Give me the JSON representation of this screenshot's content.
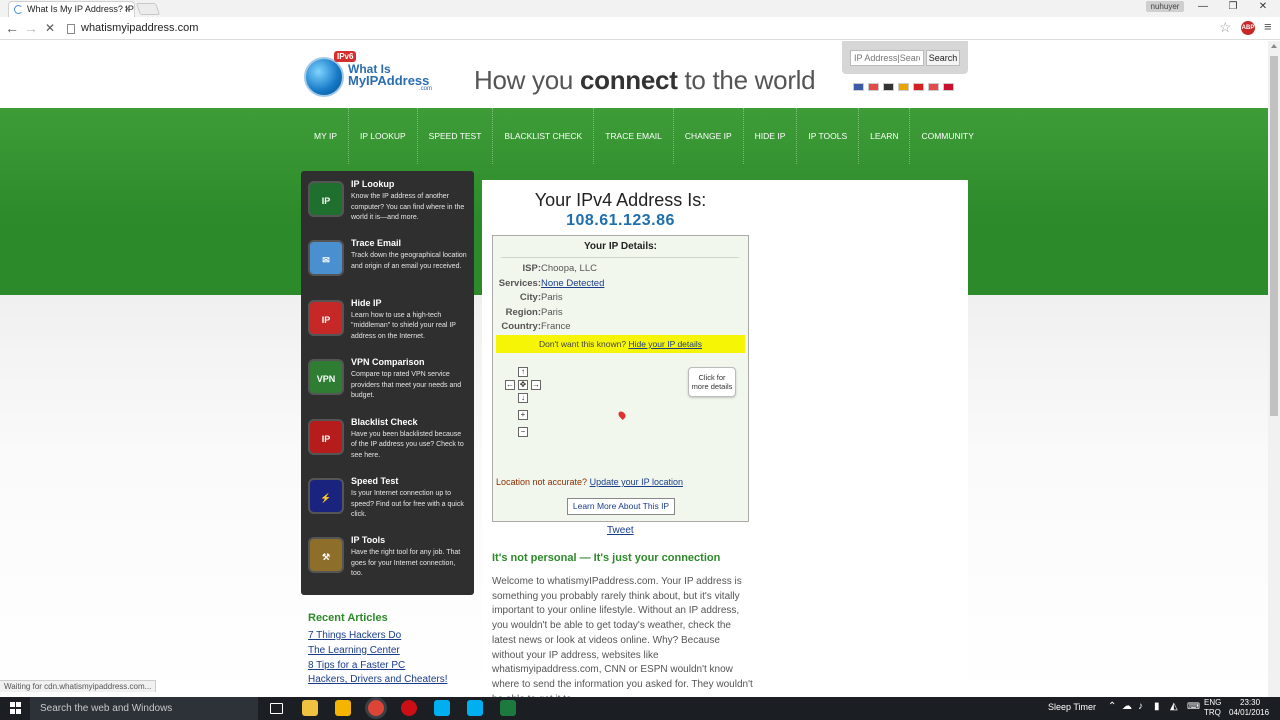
{
  "browser": {
    "tab_title": "What Is My IP Address? IP",
    "tab_close": "×",
    "profile_label": "nuhuyer",
    "window_controls": [
      "—",
      "❐",
      "✕"
    ],
    "url": "whatismyipaddress.com",
    "nav_back": "←",
    "nav_forward": "→",
    "nav_stop": "✕",
    "star": "☆",
    "ext_label": "ABP",
    "menu": "≡",
    "status_text": "Waiting for cdn.whatismyipaddress.com..."
  },
  "header": {
    "logo_badge": "IPv6",
    "logo_line1": "What Is",
    "logo_line2": "MyIPAddress",
    "logo_line3": ".com",
    "tagline_pre": "How you ",
    "tagline_bold": "connect",
    "tagline_post": " to the world",
    "search_placeholder": "IP Address|Search",
    "search_button": "Search",
    "flag_colors": [
      "#3b5ba9",
      "#e34a4a",
      "#333333",
      "#e8a400",
      "#d42020",
      "#e24b4b",
      "#c8102e"
    ]
  },
  "topnav": [
    "MY IP",
    "IP LOOKUP",
    "SPEED TEST",
    "BLACKLIST CHECK",
    "TRACE EMAIL",
    "CHANGE IP",
    "HIDE IP",
    "IP TOOLS",
    "LEARN",
    "COMMUNITY"
  ],
  "sidebar": [
    {
      "title": "IP Lookup",
      "desc": "Know the IP address of another computer? You can find where in the world it is—and more.",
      "icon_color": "#1f6f2f"
    },
    {
      "title": "Trace Email",
      "desc": "Track down the geographical location and origin of an email you received.",
      "icon_color": "#4a8fd0"
    },
    {
      "title": "Hide IP",
      "desc": "Learn how to use a high-tech \"middleman\" to shield your real IP address on the Internet.",
      "icon_color": "#c62828"
    },
    {
      "title": "VPN Comparison",
      "desc": "Compare top rated VPN service providers that meet your needs and budget.",
      "icon_color": "#2e7d32"
    },
    {
      "title": "Blacklist Check",
      "desc": "Have you been blacklisted because of the IP address you use? Check to see here.",
      "icon_color": "#b71c1c"
    },
    {
      "title": "Speed Test",
      "desc": "Is your Internet connection up to speed? Find out for free with a quick click.",
      "icon_color": "#1a237e"
    },
    {
      "title": "IP Tools",
      "desc": "Have the right tool for any job. That goes for your Internet connection, too.",
      "icon_color": "#8d6e2a"
    }
  ],
  "recent": {
    "title": "Recent Articles",
    "links": [
      "7 Things Hackers Do",
      "The Learning Center",
      "8 Tips for a Faster PC",
      "Hackers, Drivers and Cheaters!"
    ]
  },
  "main": {
    "title": "Your IPv4 Address Is:",
    "ip": "108.61.123.86",
    "details_title": "Your IP Details:",
    "rows": [
      {
        "label": "ISP:",
        "value": "Choopa, LLC"
      },
      {
        "label": "Services:",
        "value": "None Detected"
      },
      {
        "label": "City:",
        "value": "Paris"
      },
      {
        "label": "Region:",
        "value": "Paris"
      },
      {
        "label": "Country:",
        "value": "France"
      }
    ],
    "warn_text": "Don't want this known? ",
    "warn_link": "Hide your IP details",
    "map_controls": [
      "↑",
      "←",
      "✥",
      "→",
      "↓",
      "+",
      "−"
    ],
    "bubble_line1": "Click for",
    "bubble_line2": "more details",
    "loc_text": "Location not accurate? ",
    "loc_link": "Update your IP location",
    "learn_button": "Learn More About This IP",
    "tweet": "Tweet",
    "section_head": "It's not personal — It's just your connection",
    "body": "Welcome to whatismyIPaddress.com. Your IP address is something you probably rarely think about, but it's vitally important to your online lifestyle. Without an IP address, you wouldn't be able to get today's weather, check the latest news or look at videos online. Why? Because without your IP address, websites like whatismyipaddress.com, CNN or ESPN wouldn't know where to send the information you asked for. They wouldn't be able to get it to"
  },
  "taskbar": {
    "search_text": "Search the web and Windows",
    "sleep_timer": "Sleep Timer",
    "lang1": "ENG",
    "lang2": "TRQ",
    "time": "23:30",
    "date": "04/01/2016",
    "app_colors": [
      "#f0c040",
      "#f4b400",
      "#db4437",
      "#cc0f16",
      "#00aff0",
      "#00aff0",
      "#1d7a3e"
    ]
  }
}
